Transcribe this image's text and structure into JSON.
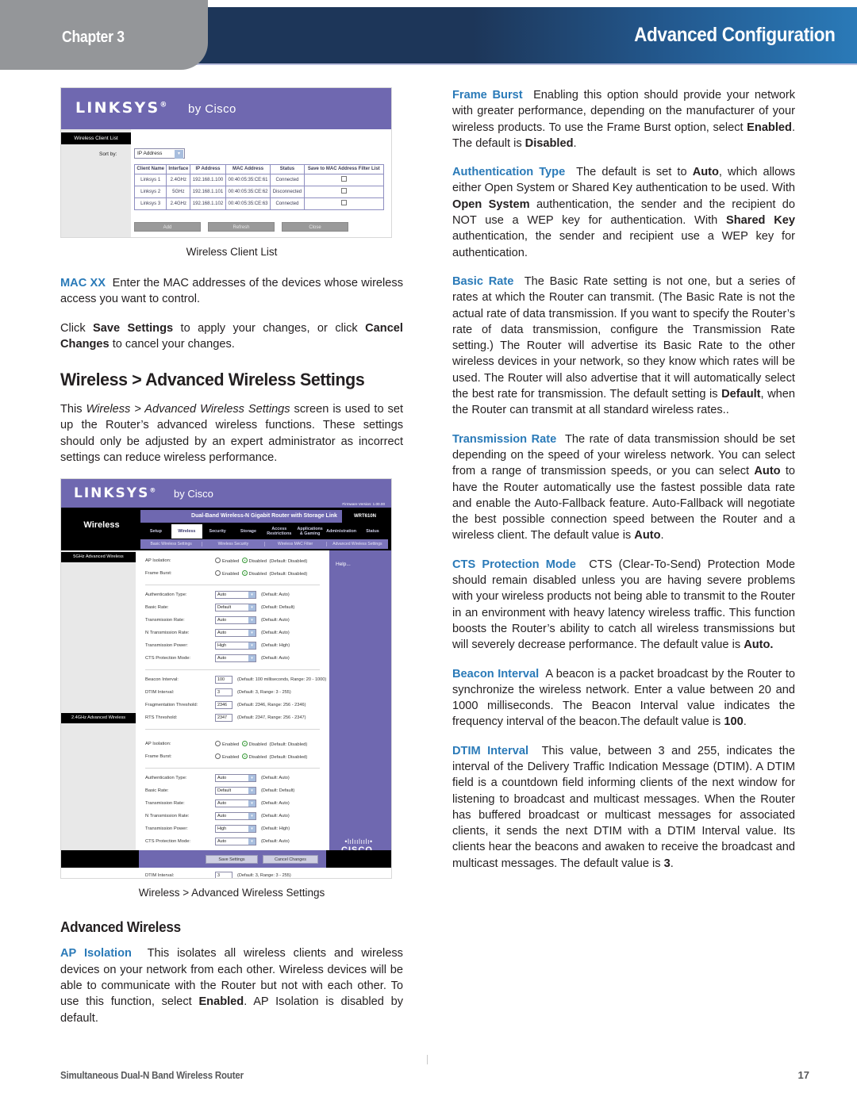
{
  "header": {
    "chapter": "Chapter 3",
    "title": "Advanced Configuration",
    "accent_dark": "#1d3659",
    "accent_light": "#2a7ab8",
    "tab_gray": "#949699"
  },
  "footer": {
    "product": "Simultaneous Dual-N Band Wireless Router",
    "page": "17"
  },
  "figures": {
    "client_list": {
      "caption": "Wireless Client List",
      "brand": "LINKSYS",
      "brand_sup": "®",
      "brand_by": "by Cisco",
      "tab_label": "Wireless Client List",
      "sort_label": "Sort by:",
      "sort_value": "IP Address",
      "columns": [
        "Client Name",
        "Interface",
        "IP Address",
        "MAC Address",
        "Status",
        "Save to MAC Address Filter List"
      ],
      "rows": [
        [
          "Linksys 1",
          "2.4GHz",
          "192.168.1.100",
          "00:40:05:35:CE:61",
          "Connected"
        ],
        [
          "Linksys 2",
          "5GHz",
          "192.168.1.101",
          "00:40:05:35:CE:62",
          "Disconnected"
        ],
        [
          "Linksys 3",
          "2.4GHz",
          "192.168.1.102",
          "00:40:05:35:CE:63",
          "Connected"
        ]
      ],
      "buttons": [
        "Add",
        "Refresh",
        "Close"
      ]
    },
    "advanced": {
      "caption": "Wireless > Advanced Wireless Settings",
      "brand": "LINKSYS",
      "brand_sup": "®",
      "brand_by": "by Cisco",
      "firmware": "Firmware Version: 1.00.00",
      "section_name": "Wireless",
      "product_bar": "Dual-Band Wireless-N Gigabit Router with Storage Link",
      "model": "WRT610N",
      "tabs": [
        "Setup",
        "Wireless",
        "Security",
        "Storage",
        "Access Restrictions",
        "Applications & Gaming",
        "Administration",
        "Status"
      ],
      "active_tab": "Wireless",
      "subtabs": [
        "Basic Wireless Settings",
        "Wireless Security",
        "Wireless MAC Filter",
        "Advanced Wireless Settings"
      ],
      "group_5ghz": "5GHz Advanced Wireless",
      "group_24ghz": "2.4GHz Advanced Wireless",
      "help_label": "Help...",
      "fields": {
        "ap_isolation": {
          "label": "AP Isolation:",
          "enabled": "Enabled",
          "disabled": "Disabled",
          "note": "(Default: Disabled)"
        },
        "frame_burst": {
          "label": "Frame Burst:",
          "enabled": "Enabled",
          "disabled": "Disabled",
          "note": "(Default: Disabled)"
        },
        "auth_type": {
          "label": "Authentication Type:",
          "value": "Auto",
          "note": "(Default: Auto)"
        },
        "basic_rate": {
          "label": "Basic Rate:",
          "value": "Default",
          "note": "(Default: Default)"
        },
        "transmission_rate": {
          "label": "Transmission Rate:",
          "value": "Auto",
          "note": "(Default: Auto)"
        },
        "n_transmission_rate": {
          "label": "N Transmission Rate:",
          "value": "Auto",
          "note": "(Default: Auto)"
        },
        "transmission_power": {
          "label": "Transmission Power:",
          "value": "High",
          "note": "(Default: High)"
        },
        "cts_protection": {
          "label": "CTS Protection Mode:",
          "value": "Auto",
          "note": "(Default: Auto)"
        },
        "beacon_interval": {
          "label": "Beacon Interval:",
          "value": "100",
          "note": "(Default: 100 milliseconds, Range: 20 - 1000)"
        },
        "dtim_interval": {
          "label": "DTIM Interval:",
          "value": "3",
          "note": "(Default: 3, Range: 3 - 255)"
        },
        "fragmentation_threshold": {
          "label": "Fragmentation Threshold:",
          "value": "2346",
          "note": "(Default: 2346, Range: 256 - 2346)"
        },
        "rts_threshold": {
          "label": "RTS Threshold:",
          "value": "2347",
          "note": "(Default: 2347, Range: 256 - 2347)"
        }
      },
      "save_button": "Save Settings",
      "cancel_button": "Cancel Changes",
      "cisco_bars": "•lılıılıılı•",
      "cisco_name": "CISCO."
    }
  },
  "left_column": {
    "mac_xx": {
      "term": "MAC XX",
      "body": "Enter the MAC addresses of the devices whose wireless access you want to control."
    },
    "save_cancel": {
      "p1": "Click ",
      "b1": "Save Settings",
      "p2": " to apply your changes, or click ",
      "b2": "Cancel Changes",
      "p3": " to cancel your changes."
    },
    "section_heading": "Wireless > Advanced Wireless Settings",
    "intro": {
      "p1": "This ",
      "i1": "Wireless > Advanced Wireless Settings",
      "p2": " screen is used to set up the Router’s advanced wireless functions. These settings should only be adjusted by an expert administrator as incorrect settings can reduce wireless performance."
    },
    "subsection_heading": "Advanced Wireless",
    "ap_isolation": {
      "term": "AP Isolation",
      "p1": "This isolates all wireless clients and wireless devices on your network from each other. Wireless devices will be able to communicate with the Router but not with each other. To use this function, select ",
      "b1": "Enabled",
      "p2": ". AP Isolation is disabled by default."
    }
  },
  "right_column": {
    "frame_burst": {
      "term": "Frame Burst",
      "p1": "Enabling this option should provide your network with greater performance, depending on the manufacturer of your wireless products. To use the Frame Burst option, select ",
      "b1": "Enabled",
      "p2": ". The default is ",
      "b2": "Disabled",
      "p3": "."
    },
    "authentication_type": {
      "term": "Authentication Type",
      "p1": "The default is set to ",
      "b1": "Auto",
      "p2": ", which allows either Open System or Shared Key authentication to be used. With ",
      "b2": "Open System",
      "p3": " authentication, the sender and the recipient do NOT use a WEP key for authentication. With ",
      "b3": "Shared Key",
      "p4": " authentication, the sender and recipient use a WEP key for authentication."
    },
    "basic_rate": {
      "term": "Basic Rate",
      "p1": "The Basic Rate setting is not one, but a series of rates at which the Router can transmit. (The Basic Rate is not the actual rate of data transmission. If you want to specify the Router’s rate of data transmission, configure the Transmission Rate setting.) The Router will advertise its Basic Rate to the other wireless devices in your network, so they know which rates will be used. The Router will also advertise that it will automatically select the best rate for transmission. The default setting is ",
      "b1": "Default",
      "p2": ", when the Router can transmit at all standard wireless rates.."
    },
    "transmission_rate": {
      "term": "Transmission Rate",
      "p1": "The rate of data transmission should be set depending on the speed of your wireless network. You can select from a range of transmission speeds, or you can select ",
      "b1": "Auto",
      "p2": " to have the Router automatically use the fastest possible data rate and enable the Auto-Fallback feature. Auto-Fallback will negotiate the best possible connection speed between the Router and a wireless client. The default value is ",
      "b2": "Auto",
      "p3": "."
    },
    "cts_protection": {
      "term": "CTS Protection Mode",
      "p1": "CTS (Clear-To-Send) Protection Mode should remain disabled unless you are having severe problems with your wireless products not being able to transmit to the Router in an environment with heavy latency wireless traffic. This function boosts the Router’s ability to catch all wireless transmissions but will severely decrease performance. The default value is ",
      "b1": "Auto."
    },
    "beacon_interval": {
      "term": "Beacon Interval",
      "p1": "A beacon is a packet broadcast by the Router to synchronize the wireless network. Enter a value between 20 and 1000 milliseconds. The Beacon Interval value indicates the frequency interval of the beacon.The default value is ",
      "b1": "100",
      "p2": "."
    },
    "dtim_interval": {
      "term": "DTIM Interval",
      "p1": "This value, between 3 and 255, indicates the interval of the Delivery Traffic Indication Message (DTIM). A DTIM field is a countdown field informing clients of the next window for listening to broadcast and multicast messages. When the Router has buffered broadcast or multicast messages for associated clients, it sends the next DTIM with a DTIM Interval value. Its clients hear the beacons and awaken to receive the broadcast and multicast messages. The default value is ",
      "b1": "3",
      "p2": "."
    }
  }
}
